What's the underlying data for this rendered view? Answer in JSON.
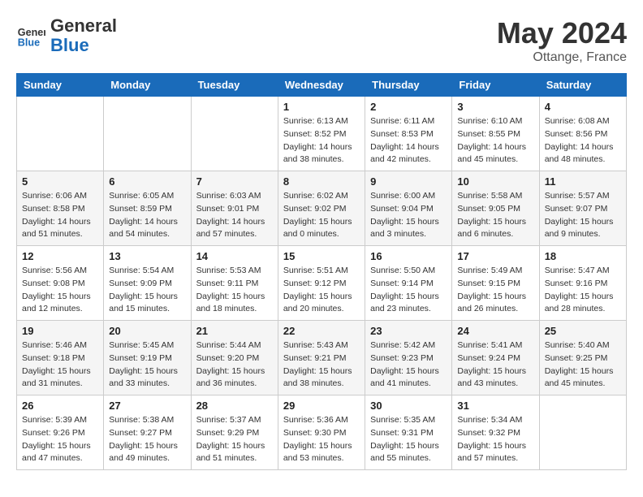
{
  "logo": {
    "text_general": "General",
    "text_blue": "Blue"
  },
  "title": "May 2024",
  "subtitle": "Ottange, France",
  "weekdays": [
    "Sunday",
    "Monday",
    "Tuesday",
    "Wednesday",
    "Thursday",
    "Friday",
    "Saturday"
  ],
  "weeks": [
    [
      null,
      null,
      null,
      {
        "day": 1,
        "sunrise": "6:13 AM",
        "sunset": "8:52 PM",
        "daylight": "14 hours and 38 minutes."
      },
      {
        "day": 2,
        "sunrise": "6:11 AM",
        "sunset": "8:53 PM",
        "daylight": "14 hours and 42 minutes."
      },
      {
        "day": 3,
        "sunrise": "6:10 AM",
        "sunset": "8:55 PM",
        "daylight": "14 hours and 45 minutes."
      },
      {
        "day": 4,
        "sunrise": "6:08 AM",
        "sunset": "8:56 PM",
        "daylight": "14 hours and 48 minutes."
      }
    ],
    [
      {
        "day": 5,
        "sunrise": "6:06 AM",
        "sunset": "8:58 PM",
        "daylight": "14 hours and 51 minutes."
      },
      {
        "day": 6,
        "sunrise": "6:05 AM",
        "sunset": "8:59 PM",
        "daylight": "14 hours and 54 minutes."
      },
      {
        "day": 7,
        "sunrise": "6:03 AM",
        "sunset": "9:01 PM",
        "daylight": "14 hours and 57 minutes."
      },
      {
        "day": 8,
        "sunrise": "6:02 AM",
        "sunset": "9:02 PM",
        "daylight": "15 hours and 0 minutes."
      },
      {
        "day": 9,
        "sunrise": "6:00 AM",
        "sunset": "9:04 PM",
        "daylight": "15 hours and 3 minutes."
      },
      {
        "day": 10,
        "sunrise": "5:58 AM",
        "sunset": "9:05 PM",
        "daylight": "15 hours and 6 minutes."
      },
      {
        "day": 11,
        "sunrise": "5:57 AM",
        "sunset": "9:07 PM",
        "daylight": "15 hours and 9 minutes."
      }
    ],
    [
      {
        "day": 12,
        "sunrise": "5:56 AM",
        "sunset": "9:08 PM",
        "daylight": "15 hours and 12 minutes."
      },
      {
        "day": 13,
        "sunrise": "5:54 AM",
        "sunset": "9:09 PM",
        "daylight": "15 hours and 15 minutes."
      },
      {
        "day": 14,
        "sunrise": "5:53 AM",
        "sunset": "9:11 PM",
        "daylight": "15 hours and 18 minutes."
      },
      {
        "day": 15,
        "sunrise": "5:51 AM",
        "sunset": "9:12 PM",
        "daylight": "15 hours and 20 minutes."
      },
      {
        "day": 16,
        "sunrise": "5:50 AM",
        "sunset": "9:14 PM",
        "daylight": "15 hours and 23 minutes."
      },
      {
        "day": 17,
        "sunrise": "5:49 AM",
        "sunset": "9:15 PM",
        "daylight": "15 hours and 26 minutes."
      },
      {
        "day": 18,
        "sunrise": "5:47 AM",
        "sunset": "9:16 PM",
        "daylight": "15 hours and 28 minutes."
      }
    ],
    [
      {
        "day": 19,
        "sunrise": "5:46 AM",
        "sunset": "9:18 PM",
        "daylight": "15 hours and 31 minutes."
      },
      {
        "day": 20,
        "sunrise": "5:45 AM",
        "sunset": "9:19 PM",
        "daylight": "15 hours and 33 minutes."
      },
      {
        "day": 21,
        "sunrise": "5:44 AM",
        "sunset": "9:20 PM",
        "daylight": "15 hours and 36 minutes."
      },
      {
        "day": 22,
        "sunrise": "5:43 AM",
        "sunset": "9:21 PM",
        "daylight": "15 hours and 38 minutes."
      },
      {
        "day": 23,
        "sunrise": "5:42 AM",
        "sunset": "9:23 PM",
        "daylight": "15 hours and 41 minutes."
      },
      {
        "day": 24,
        "sunrise": "5:41 AM",
        "sunset": "9:24 PM",
        "daylight": "15 hours and 43 minutes."
      },
      {
        "day": 25,
        "sunrise": "5:40 AM",
        "sunset": "9:25 PM",
        "daylight": "15 hours and 45 minutes."
      }
    ],
    [
      {
        "day": 26,
        "sunrise": "5:39 AM",
        "sunset": "9:26 PM",
        "daylight": "15 hours and 47 minutes."
      },
      {
        "day": 27,
        "sunrise": "5:38 AM",
        "sunset": "9:27 PM",
        "daylight": "15 hours and 49 minutes."
      },
      {
        "day": 28,
        "sunrise": "5:37 AM",
        "sunset": "9:29 PM",
        "daylight": "15 hours and 51 minutes."
      },
      {
        "day": 29,
        "sunrise": "5:36 AM",
        "sunset": "9:30 PM",
        "daylight": "15 hours and 53 minutes."
      },
      {
        "day": 30,
        "sunrise": "5:35 AM",
        "sunset": "9:31 PM",
        "daylight": "15 hours and 55 minutes."
      },
      {
        "day": 31,
        "sunrise": "5:34 AM",
        "sunset": "9:32 PM",
        "daylight": "15 hours and 57 minutes."
      },
      null
    ]
  ]
}
